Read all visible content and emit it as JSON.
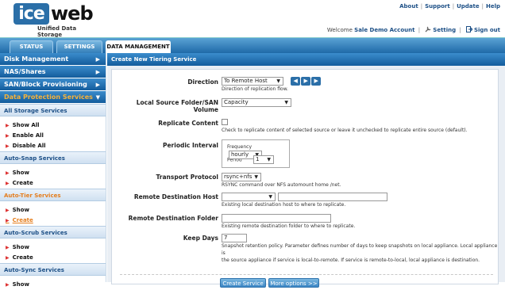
{
  "header": {
    "logo_left": "ice",
    "logo_right": "web",
    "logo_tagline": "Unified Data Storage",
    "top_links": [
      "About",
      "Support",
      "Update",
      "Help"
    ],
    "welcome_prefix": "Welcome",
    "account_name": "Sale Demo Account",
    "setting_label": "Setting",
    "signout_label": "Sign out"
  },
  "tabs": [
    {
      "label": "STATUS"
    },
    {
      "label": "SETTINGS"
    },
    {
      "label": "DATA MANAGEMENT",
      "active": true
    }
  ],
  "sidebar": {
    "accordions": [
      "Disk Management",
      "NAS/Shares",
      "SAN/Block Provisioning",
      "Data Protection Services"
    ],
    "sections": [
      {
        "title": "All Storage Services",
        "items": [
          "Show All",
          "Enable All",
          "Disable All"
        ]
      },
      {
        "title": "Auto-Snap Services",
        "items": [
          "Show",
          "Create"
        ]
      },
      {
        "title": "Auto-Tier Services",
        "items": [
          "Show",
          "Create"
        ]
      },
      {
        "title": "Auto-Scrub Services",
        "items": [
          "Show",
          "Create"
        ]
      },
      {
        "title": "Auto-Sync Services",
        "items": [
          "Show"
        ]
      }
    ]
  },
  "main": {
    "title": "Create New Tiering Service",
    "form": {
      "direction": {
        "label": "Direction",
        "value": "To Remote Host",
        "hint": "Direction of replication flow."
      },
      "source": {
        "label": "Local Source Folder/SAN Volume",
        "value": "Capacity"
      },
      "replicate": {
        "label": "Replicate Content",
        "hint": "Check to replicate content of selected source or leave it unchecked to replicate entire source (default)."
      },
      "periodic": {
        "label": "Periodic Interval",
        "frequency_label": "Frequency",
        "frequency_value": "hourly",
        "period_label": "Period",
        "period_value": "1"
      },
      "transport": {
        "label": "Transport Protocol",
        "value": "rsync+nfs",
        "hint": "RSYNC command over NFS automount home /net."
      },
      "remote_host": {
        "label": "Remote Destination Host",
        "value": "",
        "hint": "Existing local destination host to where to replicate."
      },
      "remote_folder": {
        "label": "Remote Destination Folder",
        "value": "",
        "hint": "Existing remote destination folder to where to replicate."
      },
      "keep_days": {
        "label": "Keep Days",
        "value": "7",
        "hint_line1": "Snapshot retention policy. Parameter defines number of days to keep snapshots on local appliance. Local appliance is",
        "hint_line2": "the source appliance if service is local-to-remote. If service is remote-to-local, local appliance is destination."
      }
    },
    "buttons": {
      "create": "Create Service",
      "more": "More options >>"
    }
  }
}
